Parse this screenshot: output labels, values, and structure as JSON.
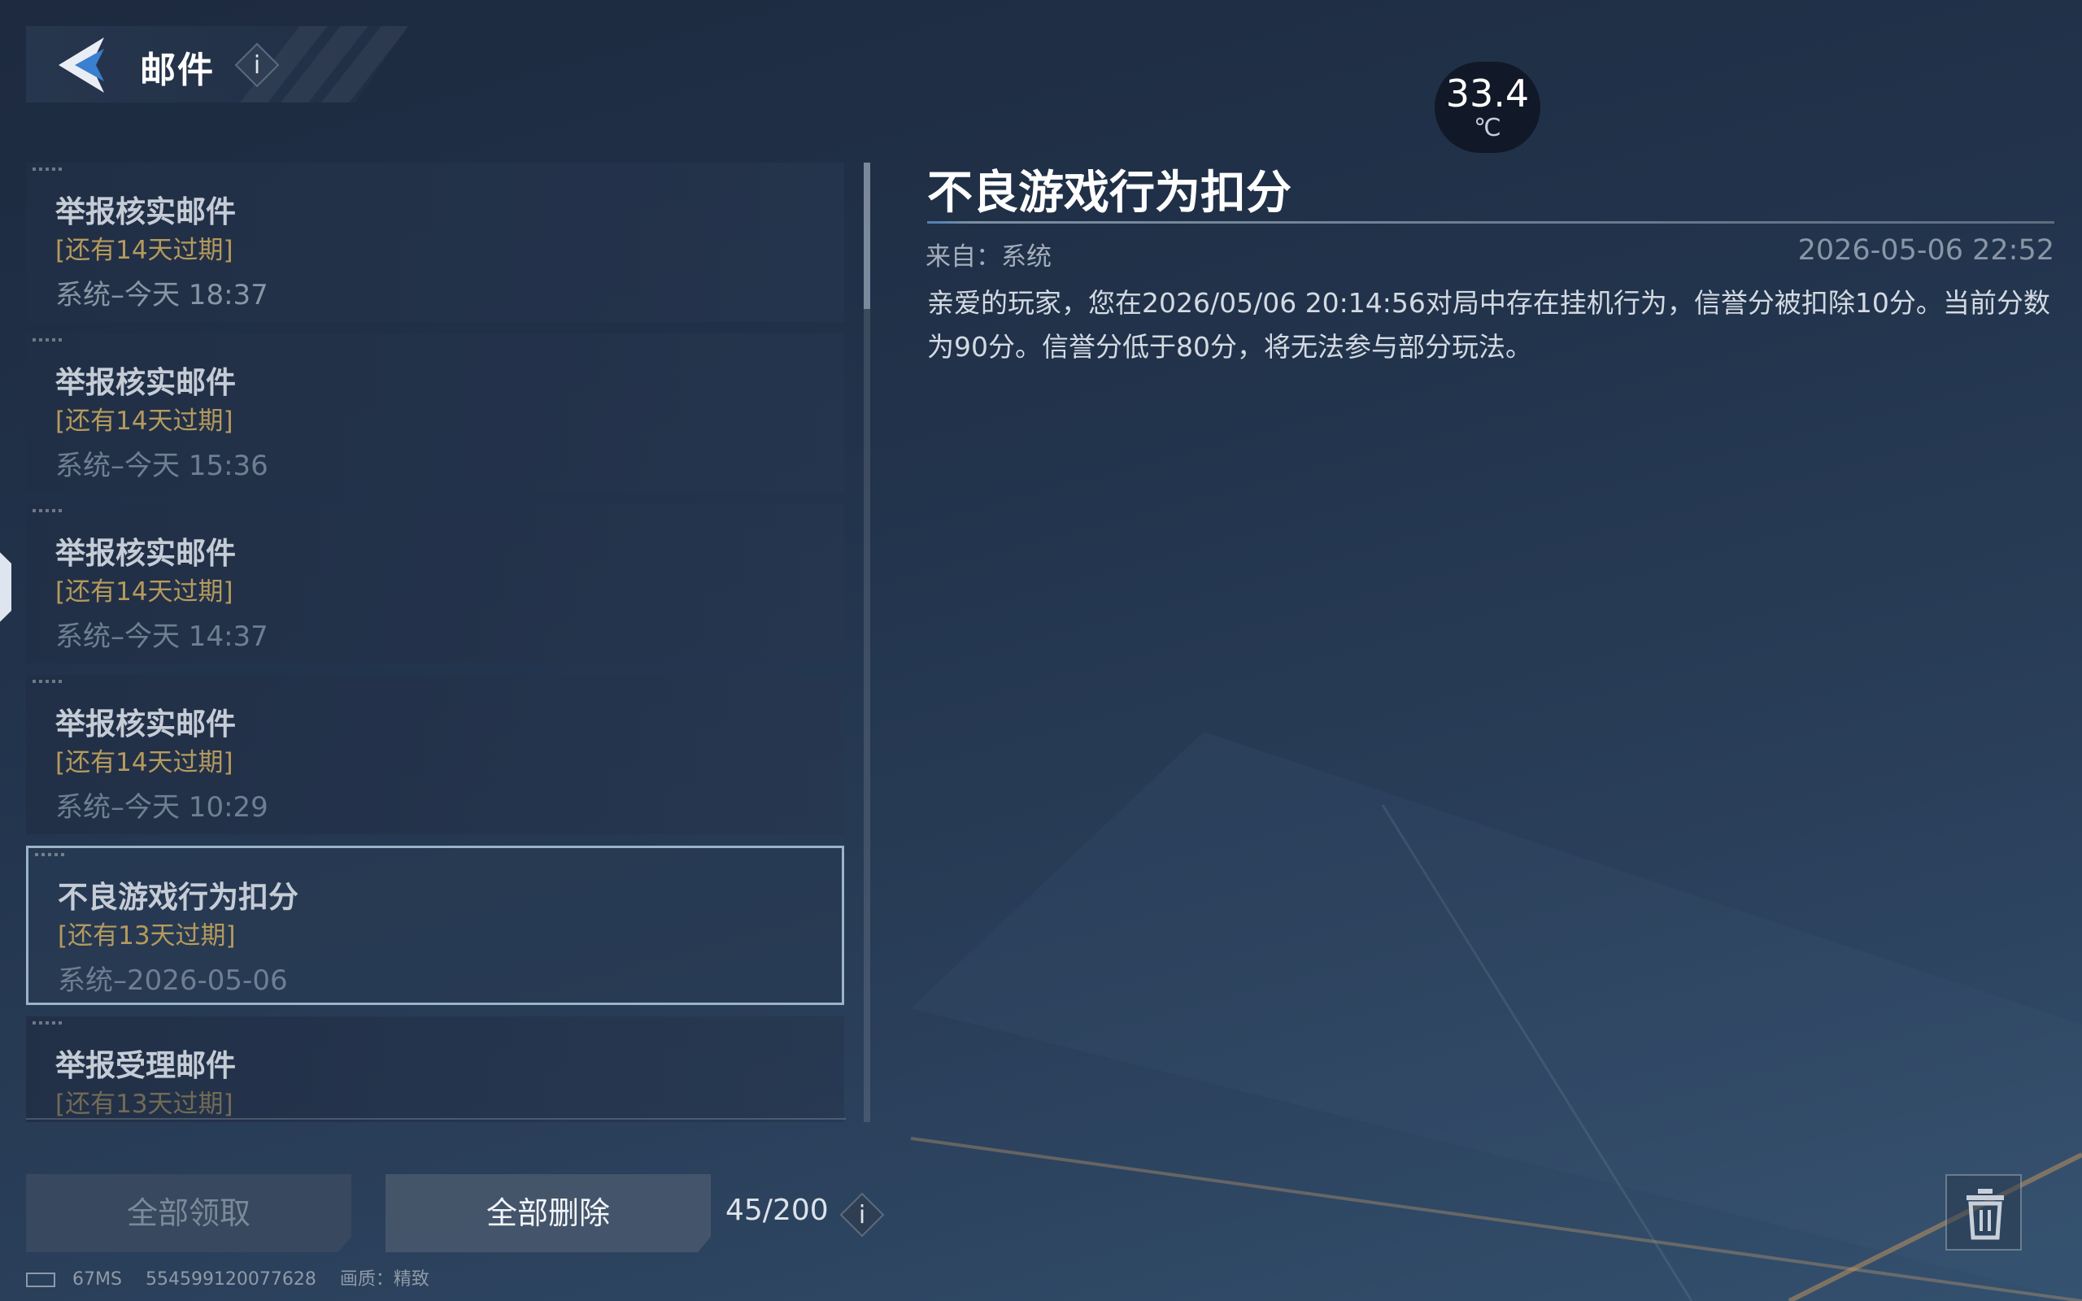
{
  "header": {
    "title": "邮件"
  },
  "temperature": {
    "value": "33.4",
    "unit": "℃"
  },
  "mail_list": [
    {
      "title": "举报核实邮件",
      "expire": "[还有14天过期]",
      "meta": "系统–今天 18:37"
    },
    {
      "title": "举报核实邮件",
      "expire": "[还有14天过期]",
      "meta": "系统–今天 15:36"
    },
    {
      "title": "举报核实邮件",
      "expire": "[还有14天过期]",
      "meta": "系统–今天 14:37"
    },
    {
      "title": "举报核实邮件",
      "expire": "[还有14天过期]",
      "meta": "系统–今天 10:29"
    },
    {
      "title": "不良游戏行为扣分",
      "expire": "[还有13天过期]",
      "meta": "系统–2026-05-06",
      "selected": true
    },
    {
      "title": "举报受理邮件",
      "expire": "[还有13天过期]",
      "meta": ""
    }
  ],
  "detail": {
    "title": "不良游戏行为扣分",
    "from": "来自：系统",
    "time": "2026-05-06 22:52",
    "body": "亲爱的玩家，您在2026/05/06 20:14:56对局中存在挂机行为，信誉分被扣除10分。当前分数为90分。信誉分低于80分，将无法参与部分玩法。"
  },
  "buttons": {
    "claim_all": "全部领取",
    "delete_all": "全部删除"
  },
  "mail_count": "45/200",
  "status_bar": {
    "ping": "67MS",
    "id": "554599120077628",
    "quality": "画质：精致"
  },
  "icons": {
    "back": "back-arrow-icon",
    "info": "info-icon",
    "trash": "trash-icon"
  },
  "colors": {
    "expire": "#b59a5d",
    "selected_border": "#9ab4c8"
  }
}
